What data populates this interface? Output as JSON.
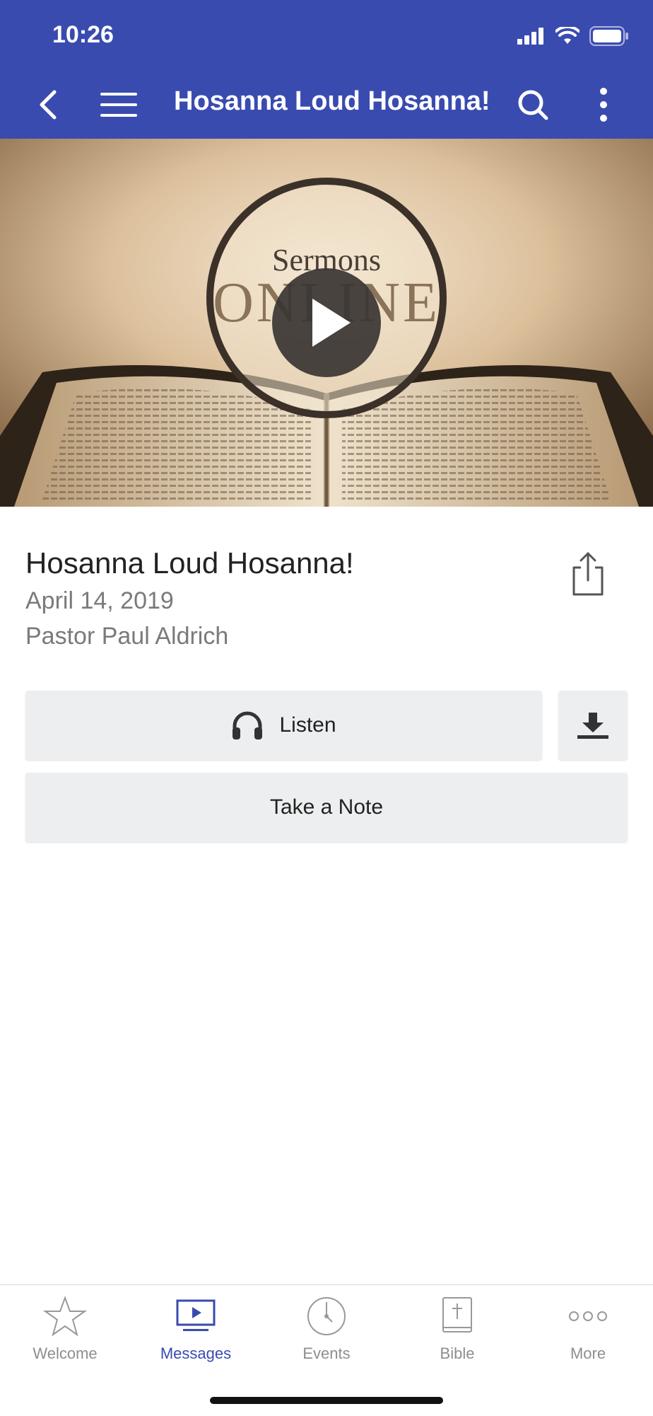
{
  "status_bar": {
    "time": "10:26"
  },
  "nav": {
    "title": "Hosanna Loud Hosanna!"
  },
  "hero": {
    "line1": "Sermons",
    "line2": "ONLINE"
  },
  "sermon": {
    "title": "Hosanna Loud Hosanna!",
    "date": "April 14, 2019",
    "speaker": "Pastor Paul Aldrich"
  },
  "actions": {
    "listen_label": "Listen",
    "note_label": "Take a Note"
  },
  "tabs": [
    {
      "label": "Welcome",
      "icon": "star-icon",
      "active": false
    },
    {
      "label": "Messages",
      "icon": "video-icon",
      "active": true
    },
    {
      "label": "Events",
      "icon": "clock-icon",
      "active": false
    },
    {
      "label": "Bible",
      "icon": "bible-icon",
      "active": false
    },
    {
      "label": "More",
      "icon": "more-dots-icon",
      "active": false
    }
  ],
  "colors": {
    "brand": "#3a4bb0",
    "button_bg": "#edeeef"
  }
}
